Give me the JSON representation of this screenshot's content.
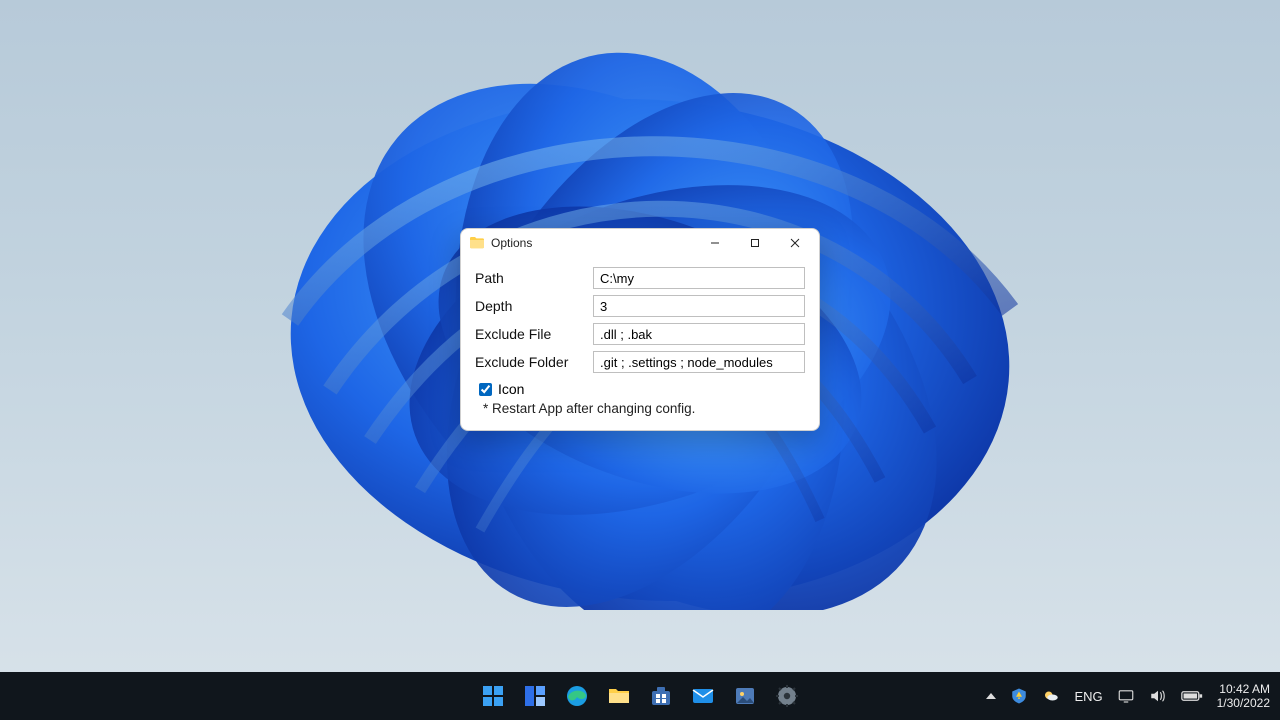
{
  "dialog": {
    "title": "Options",
    "fields": {
      "path": {
        "label": "Path",
        "value": "C:\\my"
      },
      "depth": {
        "label": "Depth",
        "value": "3"
      },
      "exfile": {
        "label": "Exclude File",
        "value": ".dll ; .bak"
      },
      "exdir": {
        "label": "Exclude Folder",
        "value": ".git ; .settings ; node_modules"
      }
    },
    "icon_checkbox": {
      "label": "Icon",
      "checked": true
    },
    "note": "* Restart App after changing config."
  },
  "taskbar": {
    "language": "ENG",
    "time": "10:42 AM",
    "date": "1/30/2022"
  },
  "icons": {
    "titlebar_icon": "folder-icon",
    "window_controls": [
      "minimize",
      "maximize",
      "close"
    ],
    "taskbar_pinned": [
      "start-icon",
      "widgets-icon",
      "edge-icon",
      "explorer-icon",
      "store-icon",
      "mail-icon",
      "photos-icon",
      "settings-icon"
    ],
    "tray": [
      "overflow-chevron-icon",
      "security-warning-icon",
      "weather-icon",
      "network-icon",
      "volume-icon",
      "battery-icon"
    ]
  }
}
